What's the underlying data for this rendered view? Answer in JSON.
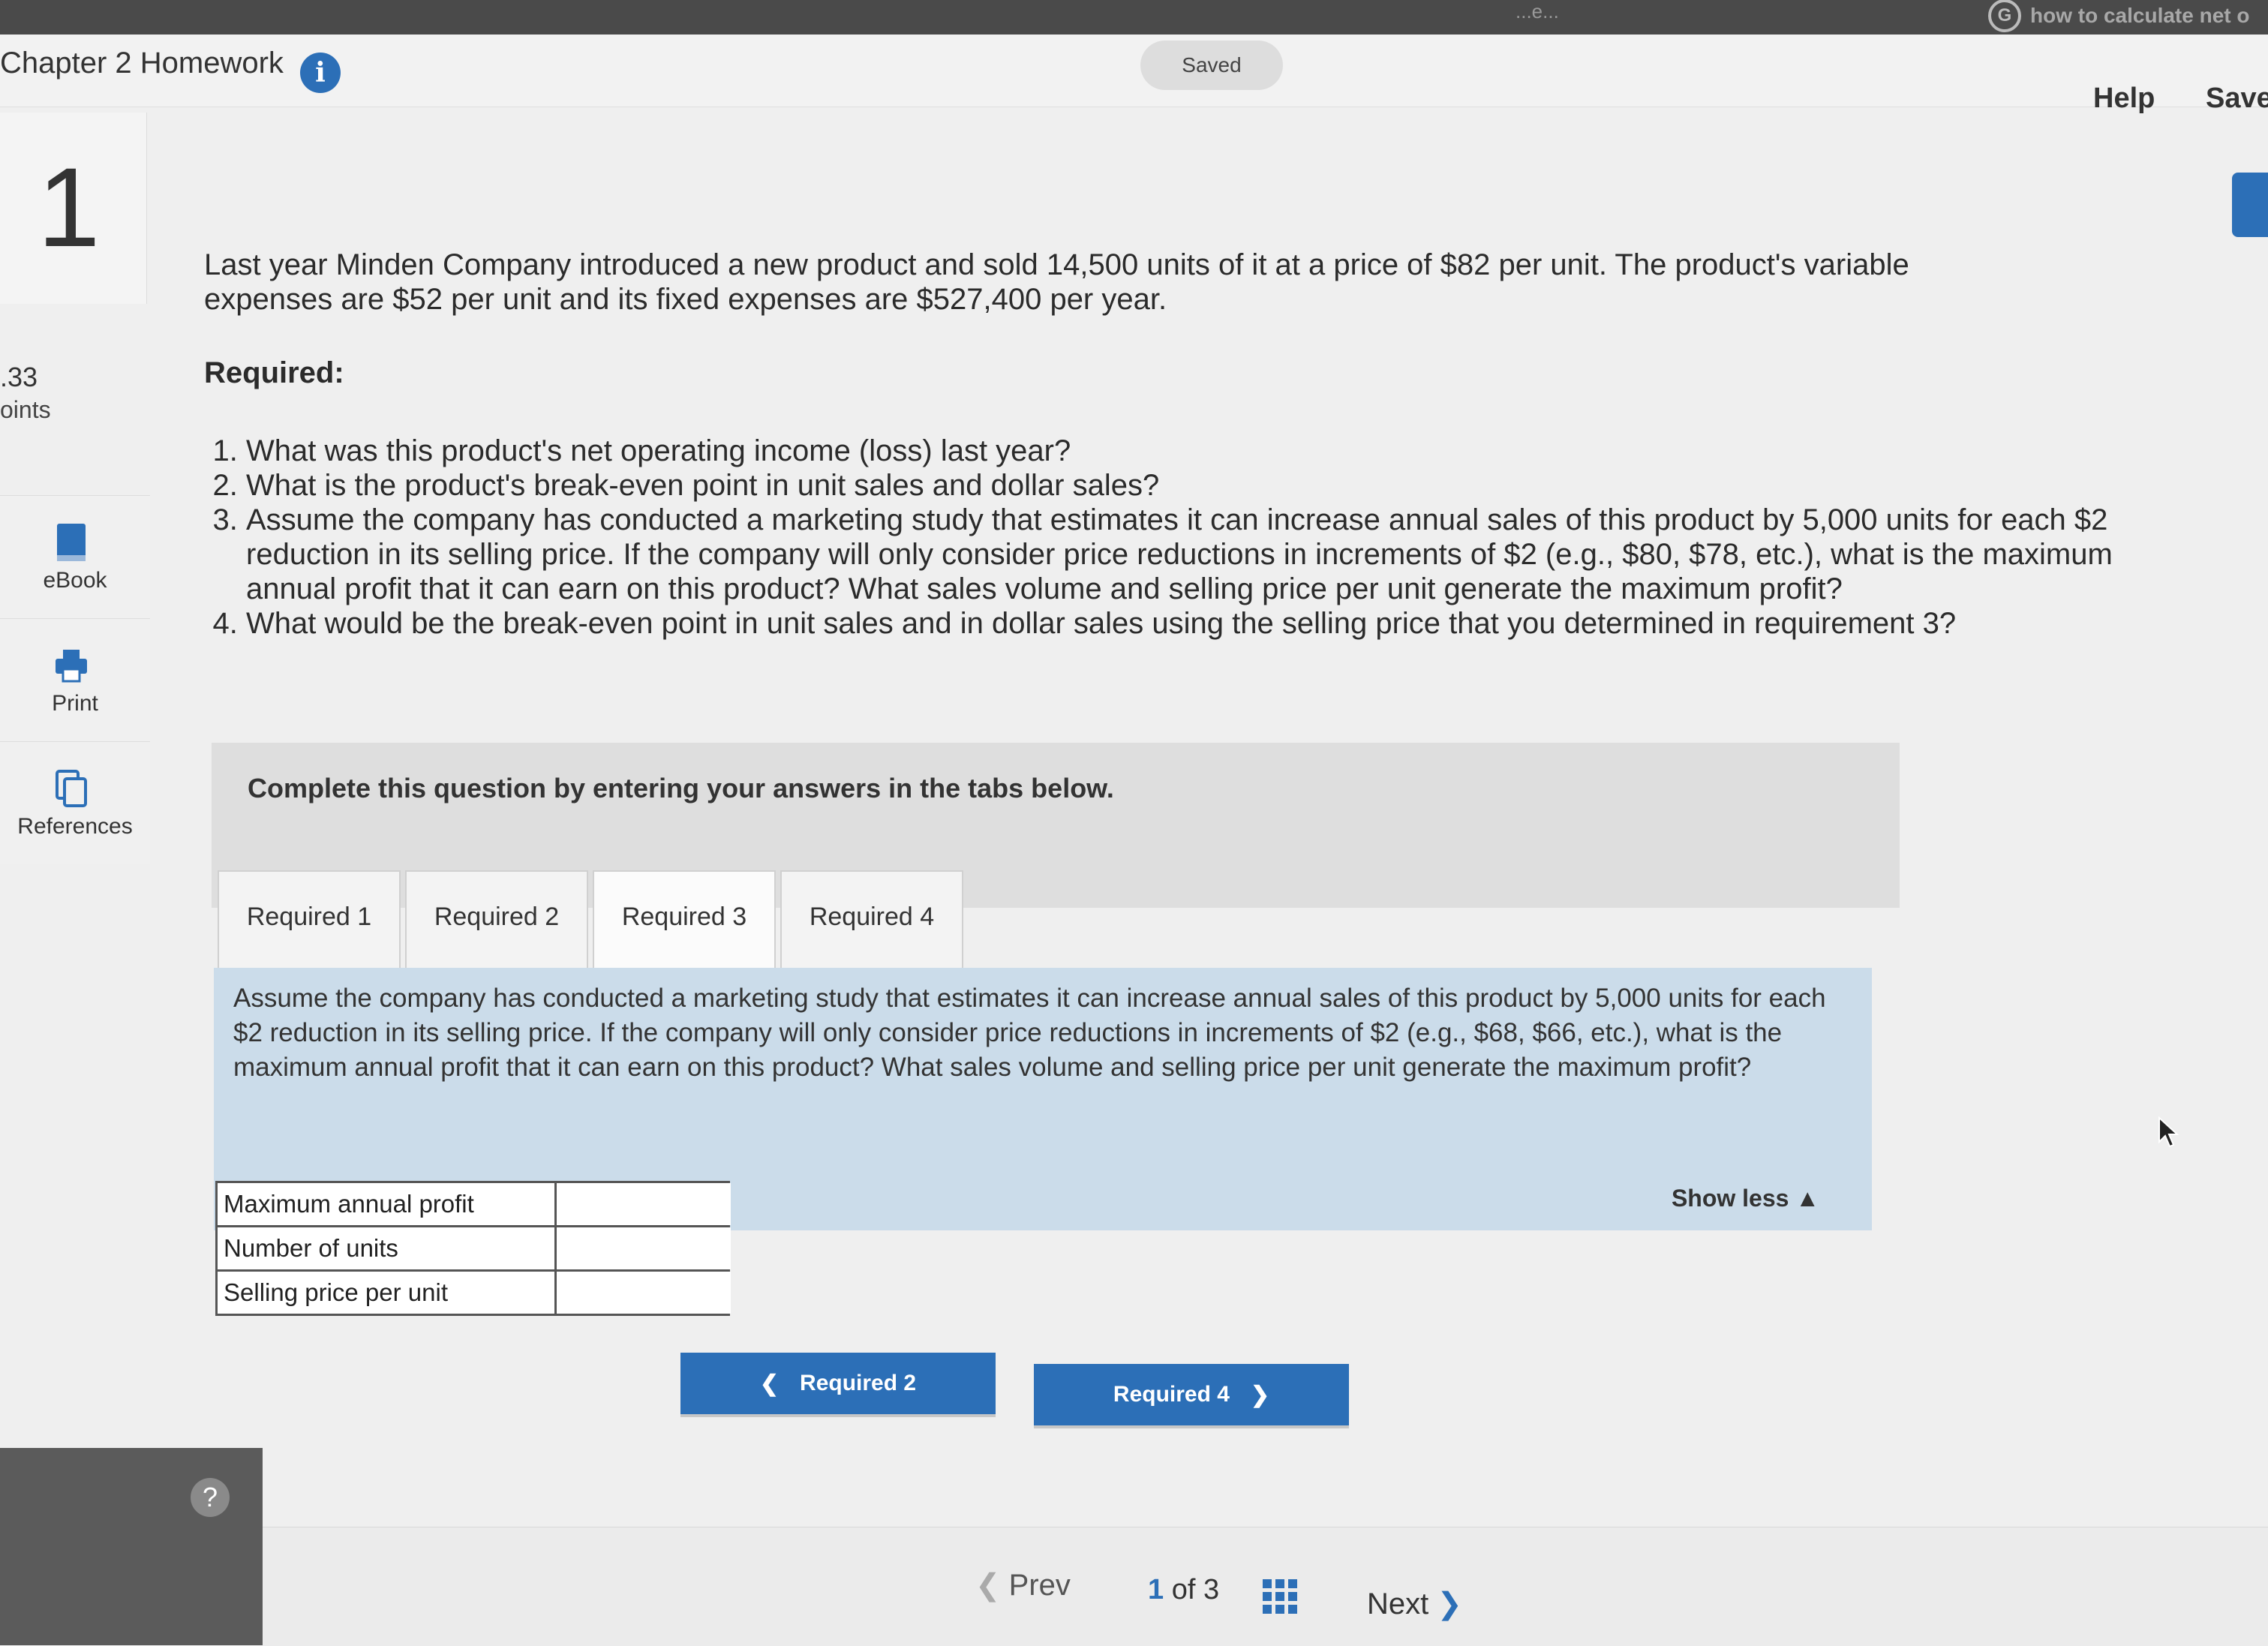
{
  "browser": {
    "top_text": "...e...",
    "search_text": "how to calculate net o"
  },
  "header": {
    "title": "Chapter 2 Homework",
    "saved_label": "Saved",
    "help_label": "Help",
    "save_label": "Save"
  },
  "question": {
    "number": "1",
    "points_value": ".33",
    "points_label": "oints"
  },
  "sidebar": {
    "items": [
      {
        "label": "eBook"
      },
      {
        "label": "Print"
      },
      {
        "label": "References"
      }
    ]
  },
  "problem": {
    "intro": "Last year Minden Company introduced a new product and sold 14,500 units of it at a price of $82 per unit. The product's variable expenses are $52 per unit and its fixed expenses are $527,400 per year.",
    "required_heading": "Required:",
    "requirements": [
      "What was this product's net operating income (loss) last year?",
      "What is the product's break-even point in unit sales and dollar sales?",
      "Assume the company has conducted a marketing study that estimates it can increase annual sales of this product by 5,000 units for each $2 reduction in its selling price. If the company will only consider price reductions in increments of $2 (e.g., $80, $78, etc.), what is the maximum annual profit that it can earn on this product? What sales volume and selling price per unit generate the maximum profit?",
      "What would be the break-even point in unit sales and in dollar sales using the selling price that you determined in requirement 3?"
    ]
  },
  "instructions": "Complete this question by entering your answers in the tabs below.",
  "tabs": [
    {
      "label": "Required 1"
    },
    {
      "label": "Required 2"
    },
    {
      "label": "Required 3"
    },
    {
      "label": "Required 4"
    }
  ],
  "active_tab": "Required 3",
  "panel": {
    "text": "Assume the company has conducted a marketing study that estimates it can increase annual sales of this product by 5,000 units for each $2 reduction in its selling price. If the company will only consider price reductions in increments of $2 (e.g., $68, $66, etc.), what is the maximum annual profit that it can earn on this product? What sales volume and selling price per unit generate the maximum profit?",
    "show_less": "Show less ▲"
  },
  "answer_rows": [
    {
      "label": "Maximum annual profit",
      "value": ""
    },
    {
      "label": "Number of units",
      "value": ""
    },
    {
      "label": "Selling price per unit",
      "value": ""
    }
  ],
  "nav": {
    "prev_required": "Required 2",
    "next_required": "Required 4",
    "prev_label": "Prev",
    "page_current": "1",
    "page_of": "of 3",
    "next_label": "Next",
    "help_symbol": "?"
  },
  "colors": {
    "accent": "#2c6fb7",
    "panel_bg": "#cbdcea"
  }
}
